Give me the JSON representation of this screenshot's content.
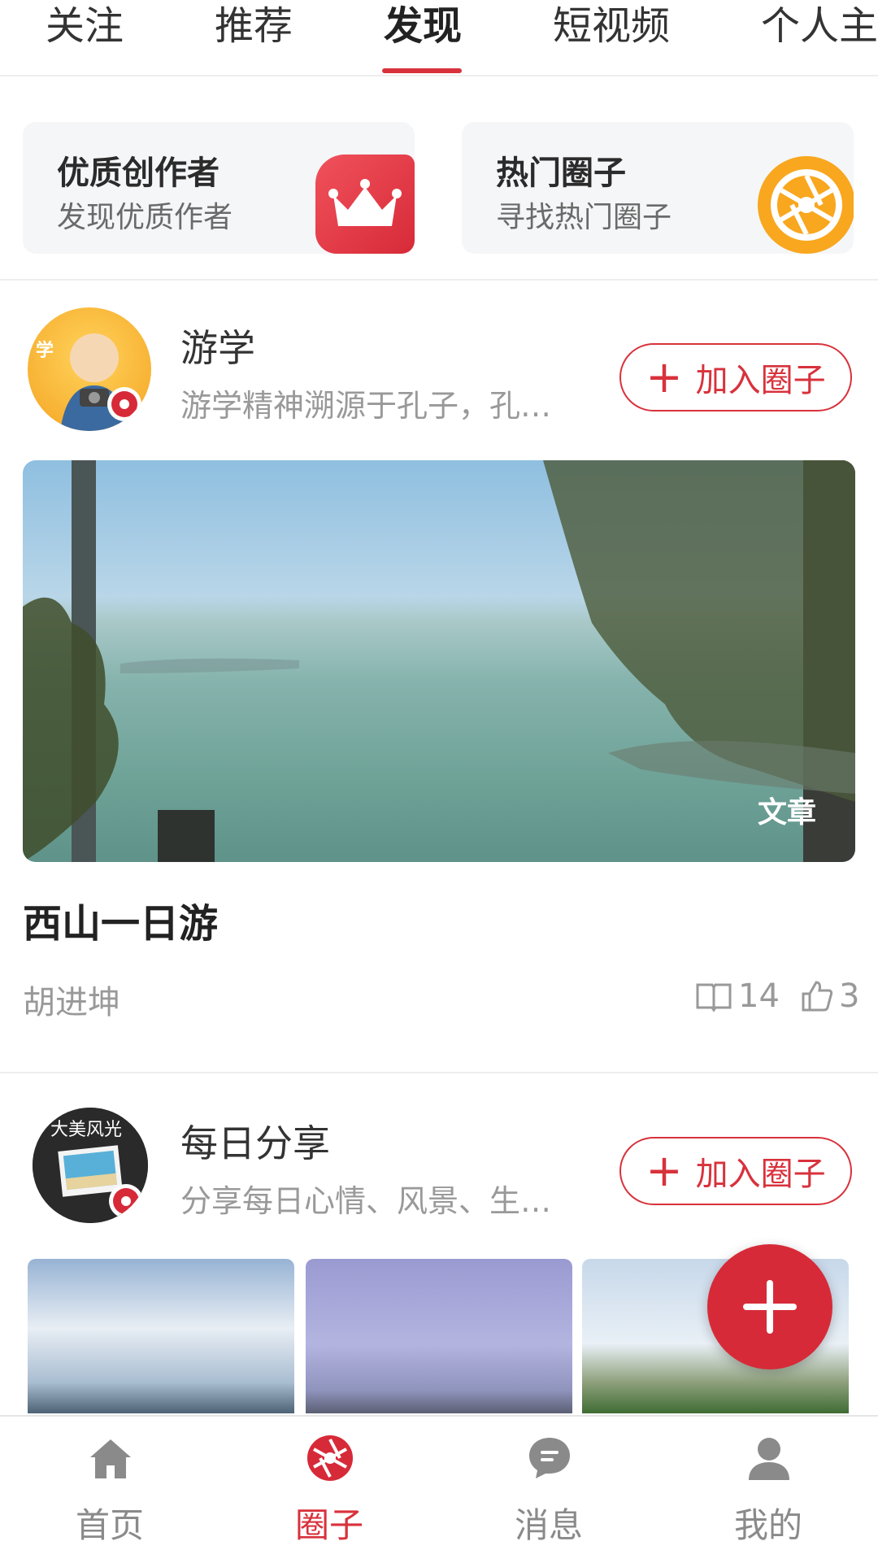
{
  "top_tabs": [
    "关注",
    "推荐",
    "发现",
    "短视频",
    "个人主"
  ],
  "active_tab": "发现",
  "feature_cards": [
    {
      "title": "优质创作者",
      "subtitle": "发现优质作者",
      "icon": "crown-icon"
    },
    {
      "title": "热门圈子",
      "subtitle": "寻找热门圈子",
      "icon": "aperture-icon"
    }
  ],
  "circles": [
    {
      "name": "游学",
      "description": "游学精神溯源于孔子，孔…",
      "join_label": "加入圈子"
    },
    {
      "name": "每日分享",
      "description": "分享每日心情、风景、生…",
      "join_label": "加入圈子"
    }
  ],
  "post": {
    "tag": "文章",
    "title": "西山一日游",
    "author": "胡进坤",
    "reads": "14",
    "likes": "3"
  },
  "bottom_nav": [
    {
      "label": "首页",
      "icon": "home-icon"
    },
    {
      "label": "圈子",
      "icon": "aperture-icon"
    },
    {
      "label": "消息",
      "icon": "message-icon"
    },
    {
      "label": "我的",
      "icon": "user-icon"
    }
  ],
  "active_nav": "圈子",
  "colors": {
    "accent": "#d8323c",
    "muted": "#999999",
    "nav_inactive": "#8a8a8a"
  }
}
